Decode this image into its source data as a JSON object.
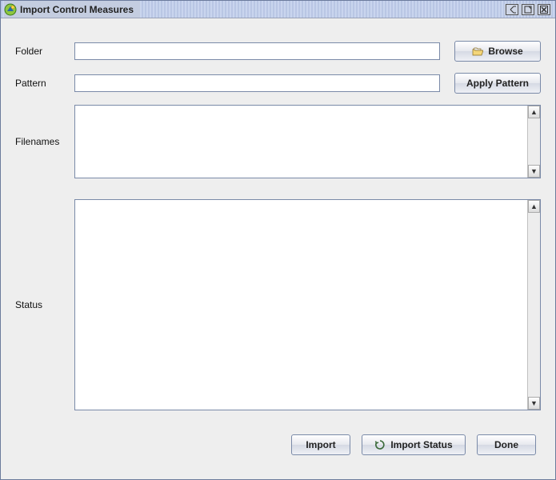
{
  "window": {
    "title": "Import Control Measures"
  },
  "labels": {
    "folder": "Folder",
    "pattern": "Pattern",
    "filenames": "Filenames",
    "status": "Status"
  },
  "inputs": {
    "folder": "",
    "pattern": "",
    "filenames": "",
    "status": ""
  },
  "buttons": {
    "browse": "Browse",
    "applyPattern": "Apply Pattern",
    "import": "Import",
    "importStatus": "Import Status",
    "done": "Done"
  }
}
